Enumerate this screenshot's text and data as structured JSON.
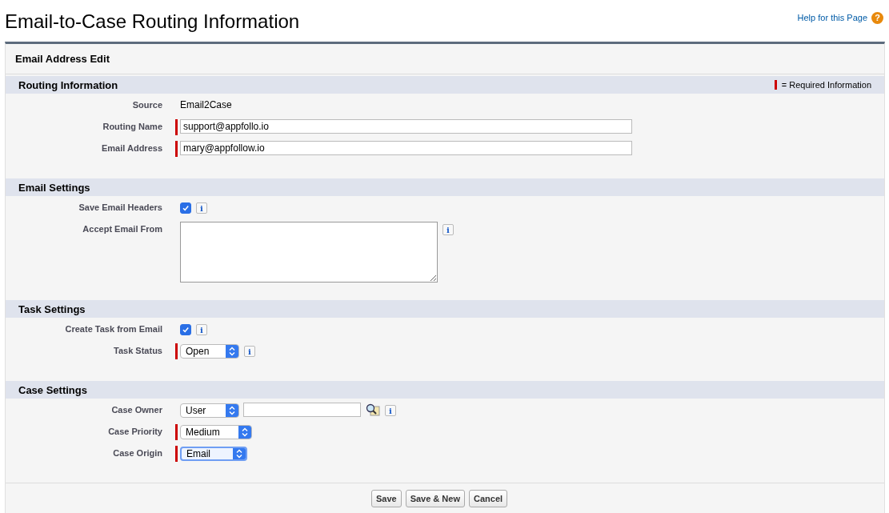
{
  "page": {
    "title": "Email-to-Case Routing Information",
    "help_link": "Help for this Page",
    "help_icon": "?"
  },
  "panel": {
    "title": "Email Address Edit",
    "legend": "= Required Information"
  },
  "sections": [
    {
      "title": "Routing Information",
      "fields": [
        {
          "kind": "text",
          "label": "Source",
          "value": "Email2Case",
          "required": false
        },
        {
          "kind": "input",
          "label": "Routing Name",
          "value": "support@appfollo.io",
          "required": true
        },
        {
          "kind": "input",
          "label": "Email Address",
          "value": "mary@appfollow.io",
          "required": true
        }
      ]
    },
    {
      "title": "Email Settings",
      "fields": [
        {
          "kind": "checkbox",
          "label": "Save Email Headers",
          "checked": true,
          "required": false,
          "info": "i"
        },
        {
          "kind": "textarea",
          "label": "Accept Email From",
          "required": false,
          "info": "i"
        }
      ]
    },
    {
      "title": "Task Settings",
      "fields": [
        {
          "kind": "checkbox",
          "label": "Create Task from Email",
          "checked": true,
          "required": false,
          "info": "i"
        },
        {
          "kind": "select",
          "label": "Task Status",
          "value": "Open",
          "required": true,
          "focused": false,
          "info": "i"
        }
      ]
    },
    {
      "title": "Case Settings",
      "fields": [
        {
          "kind": "owner",
          "label": "Case Owner",
          "value": "User",
          "required": false,
          "focused": false,
          "info": "i"
        },
        {
          "kind": "select",
          "label": "Case Priority",
          "value": "Medium",
          "required": true,
          "focused": false
        },
        {
          "kind": "select",
          "label": "Case Origin",
          "value": "Email",
          "required": true,
          "focused": true
        }
      ]
    }
  ],
  "buttons": [
    "Save",
    "Save & New",
    "Cancel"
  ]
}
